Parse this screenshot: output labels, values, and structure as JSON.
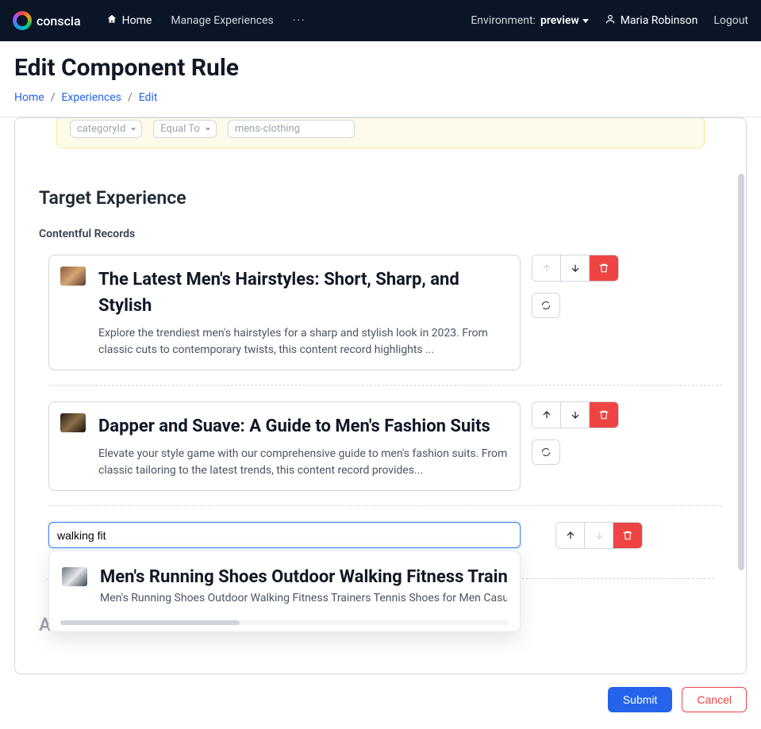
{
  "nav": {
    "brand": "conscia",
    "home": "Home",
    "manage": "Manage Experiences",
    "more": "···",
    "envLabel": "Environment:",
    "envValue": "preview",
    "user": "Maria Robinson",
    "logout": "Logout"
  },
  "header": {
    "title": "Edit Component Rule",
    "crumb1": "Home",
    "crumb2": "Experiences",
    "crumb3": "Edit"
  },
  "filter": {
    "field": "categoryId",
    "op": "Equal To",
    "value": "mens-clothing"
  },
  "section": {
    "title": "Target Experience",
    "sub": "Contentful Records"
  },
  "records": [
    {
      "title": "The Latest Men's Hairstyles: Short, Sharp, and Stylish",
      "desc": "Explore the trendiest men's hairstyles for a sharp and stylish look in 2023. From classic cuts to contemporary twists, this content record highlights ..."
    },
    {
      "title": "Dapper and Suave: A Guide to Men's Fashion Suits",
      "desc": "Elevate your style game with our comprehensive guide to men's fashion suits. From classic tailoring to the latest trends, this content record provides..."
    }
  ],
  "search": {
    "value": "walking fit"
  },
  "suggestion": {
    "title": "Men's Running Shoes Outdoor Walking Fitness Train",
    "desc": "Men's Running Shoes Outdoor Walking Fitness Trainers Tennis Shoes for Men Casual S"
  },
  "attributesHeading": "Attributes",
  "footer": {
    "submit": "Submit",
    "cancel": "Cancel"
  }
}
